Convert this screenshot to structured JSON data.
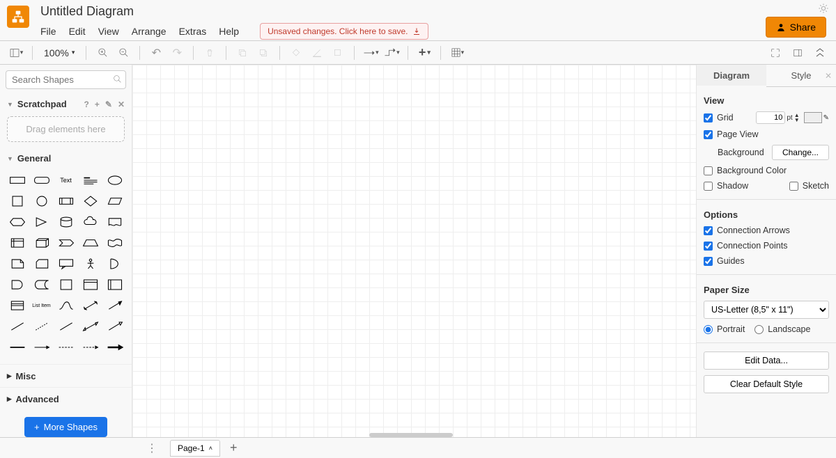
{
  "header": {
    "doc_title": "Untitled Diagram",
    "menu": [
      "File",
      "Edit",
      "View",
      "Arrange",
      "Extras",
      "Help"
    ],
    "save_badge": "Unsaved changes. Click here to save.",
    "share_label": "Share"
  },
  "toolbar": {
    "zoom": "100%"
  },
  "sidebar": {
    "search_placeholder": "Search Shapes",
    "scratchpad_label": "Scratchpad",
    "drop_hint": "Drag elements here",
    "general_label": "General",
    "misc_label": "Misc",
    "advanced_label": "Advanced",
    "more_shapes_label": "More Shapes"
  },
  "rightpanel": {
    "tabs": {
      "diagram": "Diagram",
      "style": "Style"
    },
    "view": {
      "title": "View",
      "grid_label": "Grid",
      "grid_value": "10",
      "grid_unit": "pt",
      "pageview_label": "Page View",
      "background_label": "Background",
      "change_label": "Change...",
      "bgcolor_label": "Background Color",
      "shadow_label": "Shadow",
      "sketch_label": "Sketch"
    },
    "options": {
      "title": "Options",
      "conn_arrows": "Connection Arrows",
      "conn_points": "Connection Points",
      "guides": "Guides"
    },
    "paper": {
      "title": "Paper Size",
      "selected": "US-Letter (8,5\" x 11\")",
      "portrait": "Portrait",
      "landscape": "Landscape"
    },
    "buttons": {
      "edit_data": "Edit Data...",
      "clear_style": "Clear Default Style"
    }
  },
  "footer": {
    "page_label": "Page-1"
  }
}
